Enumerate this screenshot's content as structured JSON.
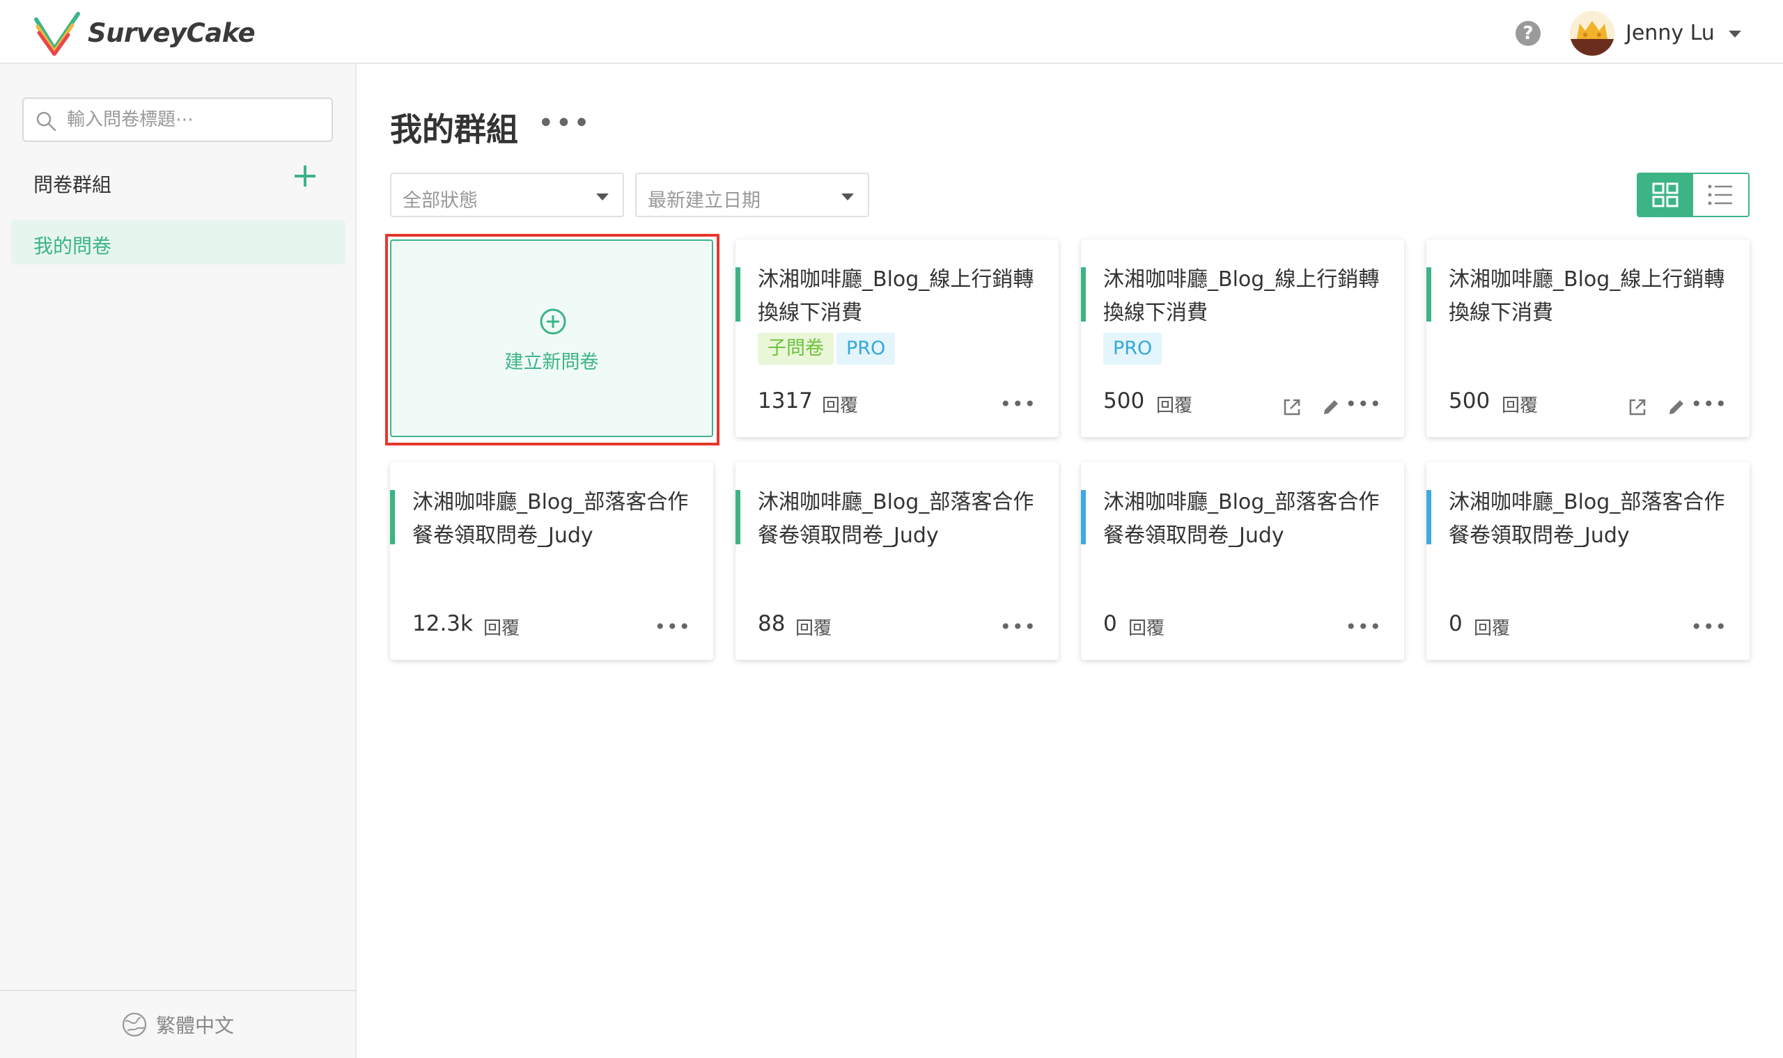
{
  "app": {
    "brand": "SurveyCake",
    "accent_color": "#3cb486"
  },
  "header": {
    "help_icon": "question-circle-icon",
    "help_glyph": "?",
    "user_name": "Jenny Lu"
  },
  "sidebar": {
    "search_placeholder": "輸入問卷標題⋯",
    "group_header": "問卷群組",
    "add_group_glyph": "+",
    "groups": [
      {
        "label": "我的問卷",
        "selected": true
      }
    ],
    "language": "繁體中文"
  },
  "main": {
    "title": "我的群組",
    "title_more": "•••",
    "filters": {
      "status": "全部狀態",
      "sort": "最新建立日期"
    },
    "view_mode": "grid",
    "new_survey_label": "建立新問卷",
    "reply_label": "回覆",
    "more_glyph": "•••",
    "cards": [
      {
        "title": "沐湘咖啡廳_Blog_線上行銷轉換線下消費",
        "tags": [
          "子問卷",
          "PRO"
        ],
        "replies": "1317",
        "accent": "#3cb486"
      },
      {
        "title": "沐湘咖啡廳_Blog_線上行銷轉換線下消費",
        "tags": [
          "PRO"
        ],
        "replies": "500",
        "accent": "#3cb486"
      },
      {
        "title": "沐湘咖啡廳_Blog_線上行銷轉換線下消費",
        "tags": [],
        "replies": "500",
        "accent": "#3cb486"
      },
      {
        "title": "沐湘咖啡廳_Blog_部落客合作餐卷領取問卷_Judy",
        "tags": [],
        "replies": "12.3k",
        "accent": "#3cb486"
      },
      {
        "title": "沐湘咖啡廳_Blog_部落客合作餐卷領取問卷_Judy",
        "tags": [],
        "replies": "88",
        "accent": "#3cb486"
      },
      {
        "title": "沐湘咖啡廳_Blog_部落客合作餐卷領取問卷_Judy",
        "tags": [],
        "replies": "0",
        "accent": "#40a9e0"
      },
      {
        "title": "沐湘咖啡廳_Blog_部落客合作餐卷領取問卷_Judy",
        "tags": [],
        "replies": "0",
        "accent": "#40a9e0"
      }
    ]
  }
}
